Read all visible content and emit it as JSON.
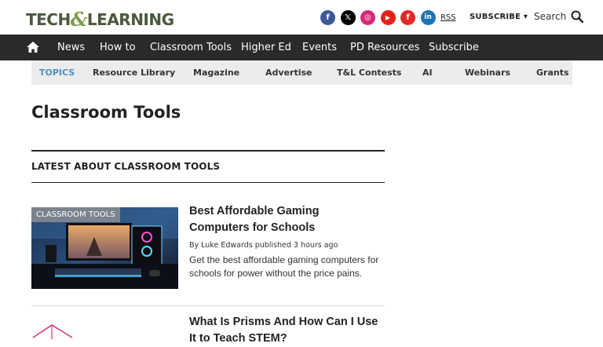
{
  "brand": {
    "logo_left": "TECH",
    "logo_amp": "&",
    "logo_right": "LEARNING",
    "logo_color": "#4a5a3c",
    "amp_color": "#7d9b4c"
  },
  "social": [
    {
      "name": "facebook-icon",
      "glyph": "f",
      "color": "#3b5998"
    },
    {
      "name": "x-icon",
      "glyph": "𝕏",
      "color": "#000000"
    },
    {
      "name": "instagram-icon",
      "glyph": "◎",
      "color": "#d6297a"
    },
    {
      "name": "youtube-icon",
      "glyph": "▶",
      "color": "#e62117"
    },
    {
      "name": "flipboard-icon",
      "glyph": "f",
      "color": "#e12828"
    },
    {
      "name": "linkedin-icon",
      "glyph": "in",
      "color": "#1d74b4"
    }
  ],
  "header": {
    "rss_label": "RSS",
    "subscribe_label": "SUBSCRIBE ▾",
    "search_label": "Search"
  },
  "nav": {
    "items": [
      "News",
      "How to",
      "Classroom Tools",
      "Higher Ed",
      "Events",
      "PD Resources",
      "Subscribe"
    ]
  },
  "topics": {
    "items": [
      "TOPICS",
      "Resource Library",
      "Magazine",
      "Advertise",
      "T&L Contests",
      "AI",
      "Webinars",
      "Grants"
    ],
    "active_color": "#4a8ec6"
  },
  "page": {
    "title": "Classroom Tools",
    "section_heading": "LATEST ABOUT CLASSROOM TOOLS"
  },
  "articles": [
    {
      "badge": "CLASSROOM TOOLS",
      "title_line1": "Best Affordable Gaming",
      "title_line2": "Computers for Schools",
      "meta": "By Luke Edwards published 3 hours ago",
      "desc_line1": "Get the best affordable gaming computers for",
      "desc_line2": "schools for power without the price pains."
    },
    {
      "title_line1": "What Is Prisms And How Can I Use",
      "title_line2": "It to Teach STEM?"
    }
  ]
}
